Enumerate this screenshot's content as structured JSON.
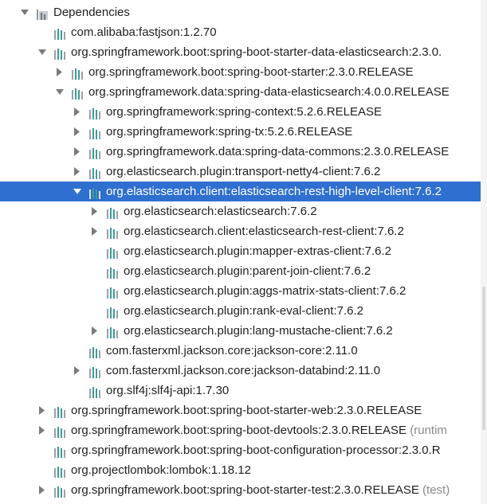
{
  "tree": {
    "rows": [
      {
        "level": 0,
        "expander": "down",
        "icon": "folder-icon",
        "label": "Dependencies",
        "suffix": ""
      },
      {
        "level": 1,
        "expander": "none",
        "icon": "library-icon",
        "label": "com.alibaba:fastjson:1.2.70",
        "suffix": ""
      },
      {
        "level": 1,
        "expander": "down",
        "icon": "library-icon",
        "label": "org.springframework.boot:spring-boot-starter-data-elasticsearch:2.3.0.",
        "suffix": ""
      },
      {
        "level": 2,
        "expander": "right",
        "icon": "library-icon",
        "label": "org.springframework.boot:spring-boot-starter:2.3.0.RELEASE",
        "suffix": ""
      },
      {
        "level": 2,
        "expander": "down",
        "icon": "library-icon",
        "label": "org.springframework.data:spring-data-elasticsearch:4.0.0.RELEASE",
        "suffix": ""
      },
      {
        "level": 3,
        "expander": "right",
        "icon": "library-icon",
        "label": "org.springframework:spring-context:5.2.6.RELEASE",
        "suffix": ""
      },
      {
        "level": 3,
        "expander": "right",
        "icon": "library-icon",
        "label": "org.springframework:spring-tx:5.2.6.RELEASE",
        "suffix": ""
      },
      {
        "level": 3,
        "expander": "right",
        "icon": "library-icon",
        "label": "org.springframework.data:spring-data-commons:2.3.0.RELEASE",
        "suffix": ""
      },
      {
        "level": 3,
        "expander": "right",
        "icon": "library-icon",
        "label": "org.elasticsearch.plugin:transport-netty4-client:7.6.2",
        "suffix": ""
      },
      {
        "level": 3,
        "expander": "down",
        "icon": "library-icon",
        "label": "org.elasticsearch.client:elasticsearch-rest-high-level-client:7.6.2",
        "suffix": "",
        "selected": true
      },
      {
        "level": 4,
        "expander": "right",
        "icon": "library-icon",
        "label": "org.elasticsearch:elasticsearch:7.6.2",
        "suffix": ""
      },
      {
        "level": 4,
        "expander": "right",
        "icon": "library-icon",
        "label": "org.elasticsearch.client:elasticsearch-rest-client:7.6.2",
        "suffix": ""
      },
      {
        "level": 4,
        "expander": "none",
        "icon": "library-icon",
        "label": "org.elasticsearch.plugin:mapper-extras-client:7.6.2",
        "suffix": ""
      },
      {
        "level": 4,
        "expander": "none",
        "icon": "library-icon",
        "label": "org.elasticsearch.plugin:parent-join-client:7.6.2",
        "suffix": ""
      },
      {
        "level": 4,
        "expander": "none",
        "icon": "library-icon",
        "label": "org.elasticsearch.plugin:aggs-matrix-stats-client:7.6.2",
        "suffix": ""
      },
      {
        "level": 4,
        "expander": "none",
        "icon": "library-icon",
        "label": "org.elasticsearch.plugin:rank-eval-client:7.6.2",
        "suffix": ""
      },
      {
        "level": 4,
        "expander": "right",
        "icon": "library-icon",
        "label": "org.elasticsearch.plugin:lang-mustache-client:7.6.2",
        "suffix": ""
      },
      {
        "level": 3,
        "expander": "none",
        "icon": "library-icon",
        "label": "com.fasterxml.jackson.core:jackson-core:2.11.0",
        "suffix": ""
      },
      {
        "level": 3,
        "expander": "right",
        "icon": "library-icon",
        "label": "com.fasterxml.jackson.core:jackson-databind:2.11.0",
        "suffix": ""
      },
      {
        "level": 3,
        "expander": "none",
        "icon": "library-icon",
        "label": "org.slf4j:slf4j-api:1.7.30",
        "suffix": ""
      },
      {
        "level": 1,
        "expander": "right",
        "icon": "library-icon",
        "label": "org.springframework.boot:spring-boot-starter-web:2.3.0.RELEASE",
        "suffix": ""
      },
      {
        "level": 1,
        "expander": "right",
        "icon": "library-icon",
        "label": "org.springframework.boot:spring-boot-devtools:2.3.0.RELEASE",
        "suffix": " (runtim"
      },
      {
        "level": 1,
        "expander": "none",
        "icon": "library-icon",
        "label": "org.springframework.boot:spring-boot-configuration-processor:2.3.0.R",
        "suffix": ""
      },
      {
        "level": 1,
        "expander": "none",
        "icon": "library-icon",
        "label": "org.projectlombok:lombok:1.18.12",
        "suffix": ""
      },
      {
        "level": 1,
        "expander": "right",
        "icon": "library-icon",
        "label": "org.springframework.boot:spring-boot-starter-test:2.3.0.RELEASE",
        "suffix": " (test)"
      }
    ]
  },
  "colors": {
    "selection": "#2f6fcf",
    "library_bar_teal": "#3d9c95",
    "library_bar_gray": "#9aa0a6",
    "arrow": "#7a7a7a"
  }
}
